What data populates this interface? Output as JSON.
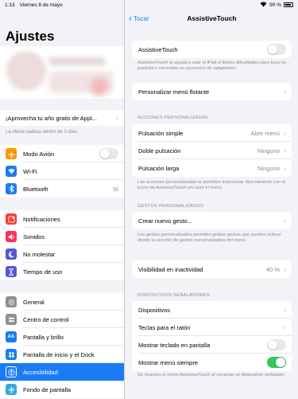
{
  "status": {
    "time": "1:13",
    "date": "Viernes 8 de mayo",
    "battery": "90 %"
  },
  "sidebar": {
    "title": "Ajustes",
    "promo": {
      "label": "¡Aprovecha tu año gratis de Appl...",
      "note": "La oferta caduca dentro de 3 días."
    },
    "group1": [
      {
        "label": "Modo Avión",
        "icon": "airplane-icon",
        "color": "#ff9500"
      },
      {
        "label": "Wi-Fi",
        "icon": "wifi-icon",
        "color": "#1a7cf5"
      },
      {
        "label": "Bluetooth",
        "icon": "bluetooth-icon",
        "color": "#1a7cf5",
        "value": "Sí"
      }
    ],
    "group2": [
      {
        "label": "Notificaciones",
        "icon": "notifications-icon",
        "color": "#ff3b30"
      },
      {
        "label": "Sonidos",
        "icon": "sounds-icon",
        "color": "#ff2d55"
      },
      {
        "label": "No molestar",
        "icon": "moon-icon",
        "color": "#5856d6"
      },
      {
        "label": "Tiempo de uso",
        "icon": "hourglass-icon",
        "color": "#5856d6"
      }
    ],
    "group3": [
      {
        "label": "General",
        "icon": "gear-icon",
        "color": "#8e8e93"
      },
      {
        "label": "Centro de control",
        "icon": "control-center-icon",
        "color": "#8e8e93"
      },
      {
        "label": "Pantalla y brillo",
        "icon": "display-icon",
        "color": "#1a7cf5",
        "glyph": "AA"
      },
      {
        "label": "Pantalla de inicio y el Dock",
        "icon": "home-screen-icon",
        "color": "#1a7cf5"
      },
      {
        "label": "Accesibilidad",
        "icon": "accessibility-icon",
        "color": "#1a7cf5"
      },
      {
        "label": "Fondo de pantalla",
        "icon": "wallpaper-icon",
        "color": "#34aadc"
      }
    ]
  },
  "detail": {
    "back_label": "Tocar",
    "title": "AssistiveTouch",
    "assistive": {
      "label": "AssistiveTouch",
      "note": "AssistiveTouch te ayuda a usar el iPad si tienes dificultades para tocar la pantalla o necesitas un accesorio de adaptación."
    },
    "menu": {
      "label": "Personalizar menú flotante"
    },
    "actions_header": "ACCIONES PERSONALIZADAS",
    "actions": [
      {
        "label": "Pulsación simple",
        "value": "Abrir menú"
      },
      {
        "label": "Doble pulsación",
        "value": "Ninguno"
      },
      {
        "label": "Pulsación larga",
        "value": "Ninguno"
      }
    ],
    "actions_note": "Las acciones personalizadas te permiten interactuar directamente con el icono de AssistiveTouch sin abrir el menú.",
    "gestures_header": "GESTOS PERSONALIZADOS",
    "gestures": {
      "label": "Crear nuevo gesto..."
    },
    "gestures_note": "Los gestos personalizados permiten grabar gestos que puedes activar desde la sección de gestos personalizados del menú.",
    "idle": {
      "label": "Visibilidad en inactividad",
      "value": "40 %"
    },
    "pointer_header": "DISPOSITIVOS SEÑALADORES",
    "pointer": [
      {
        "label": "Dispositivos"
      },
      {
        "label": "Teclas para el ratón"
      },
      {
        "label": "Mostrar teclado en pantalla"
      },
      {
        "label": "Mostrar menú siempre"
      }
    ],
    "pointer_note": "Se muestra el menú AssistiveTouch al conectar un dispositivo señalador."
  }
}
